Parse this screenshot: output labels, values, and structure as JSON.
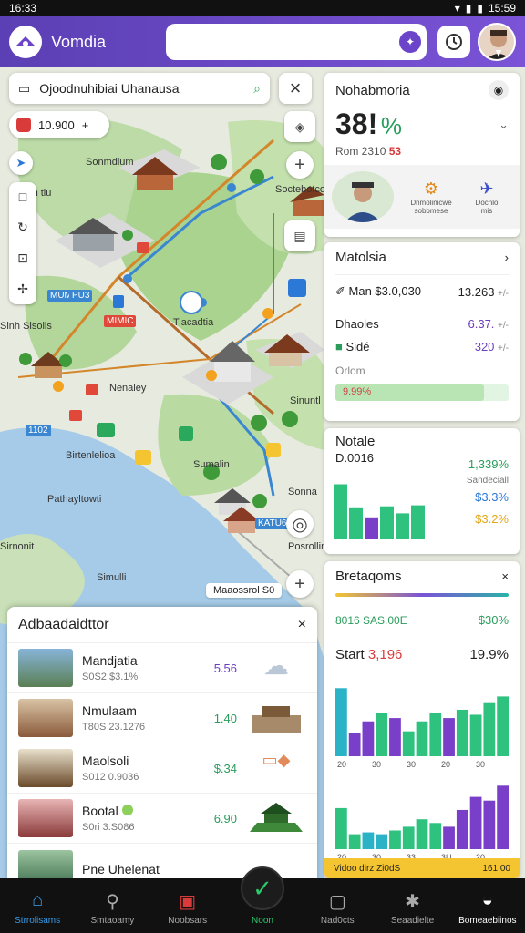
{
  "status": {
    "time": "16:33",
    "time_right": "15:59"
  },
  "app": {
    "title": "Vomdia",
    "search_placeholder": ""
  },
  "map": {
    "search_text": "Ojoodnuhibiai Uhanausa",
    "chip_value": "10.900",
    "scale_label": "Maaossrol S0",
    "labels": [
      "Sonmdium",
      "Sodn tiu",
      "Soctebotco",
      "Sinh Sisolis",
      "Tiacadtia",
      "Nenaley",
      "Sinuntl",
      "Birtenlelioa",
      "Pathayltowti",
      "Sirnonit",
      "Simulli",
      "Posrollin",
      "Sonna",
      "Sumalin"
    ],
    "tags": [
      "MUMC",
      "PU3",
      "MIMIC",
      "1102",
      "KATU6"
    ]
  },
  "card1": {
    "title": "Nohabmoria",
    "big": "38!",
    "unit": "%",
    "sub": "Rom 2310",
    "sub_accent": "53",
    "thumbs": [
      "Dnmolinicwe\nsobbmese",
      "Dochlo\nmis"
    ]
  },
  "card2": {
    "title": "Matolsia",
    "rows": [
      {
        "label": "Man $3.0,030",
        "value": "13.263",
        "action": "+/-"
      },
      {
        "label": "Dhaoles",
        "value": "6.37.",
        "action": "+/-"
      },
      {
        "label": "Sidé",
        "value": "320",
        "action": "+/-"
      }
    ],
    "footer_label": "Orlom",
    "progress_text": "9.99%",
    "progress": 0.86
  },
  "card3": {
    "title": "Notale",
    "sub": "D.0016",
    "values": [
      "1,339%",
      "Sandeciall",
      "$3.3%",
      "$3.2%"
    ],
    "bars": [
      5.5,
      3.2,
      2.2,
      3.3,
      2.6,
      3.4
    ]
  },
  "card4": {
    "title": "Bretaqoms",
    "row_label": "8016 SAS.00E",
    "row_value": "$30%",
    "start_label": "Start",
    "start_value": "3,196",
    "start_pct": "19.9%",
    "chart1": {
      "ticks": [
        "20",
        "30",
        "30",
        "20",
        "30"
      ],
      "bars": [
        4.1,
        1.4,
        2.1,
        2.6,
        2.3,
        1.5,
        2.1,
        2.6,
        2.3,
        2.8,
        2.5,
        3.2,
        3.6
      ]
    },
    "chart2": {
      "ticks": [
        "20",
        "30",
        "33",
        "3U",
        "20"
      ],
      "bars": [
        2.2,
        0.8,
        0.9,
        0.8,
        1.0,
        1.2,
        1.6,
        1.4,
        1.2,
        2.1,
        2.8,
        2.6,
        3.4
      ]
    },
    "footer_left": "Vidoo dirz Zi0dS",
    "footer_right": "161.00"
  },
  "panel": {
    "title": "Adbaadaidttor",
    "items": [
      {
        "title": "Mandjatia",
        "sub": "S0S2 $3.1%",
        "value": "5.56",
        "value_color": "#6b3fc0"
      },
      {
        "title": "Nmulaam",
        "sub": "T80S 23.1276",
        "value": "1.40",
        "value_color": "#2a9d5c"
      },
      {
        "title": "Maolsoli",
        "sub": "S012 0.9036",
        "value": "$.34",
        "value_color": "#2a9d5c"
      },
      {
        "title": "Bootal",
        "sub": "S0ri 3.S086",
        "value": "6.90",
        "value_color": "#2a9d5c"
      },
      {
        "title": "Pne Uhelenat",
        "sub": "",
        "value": "",
        "value_color": "#333"
      }
    ]
  },
  "nav": {
    "items": [
      "Strrolisams",
      "Smtaoamy",
      "Noobsars",
      "Noon",
      "Nad0cts",
      "Seaadielte",
      "Bomeaebiinos"
    ]
  }
}
